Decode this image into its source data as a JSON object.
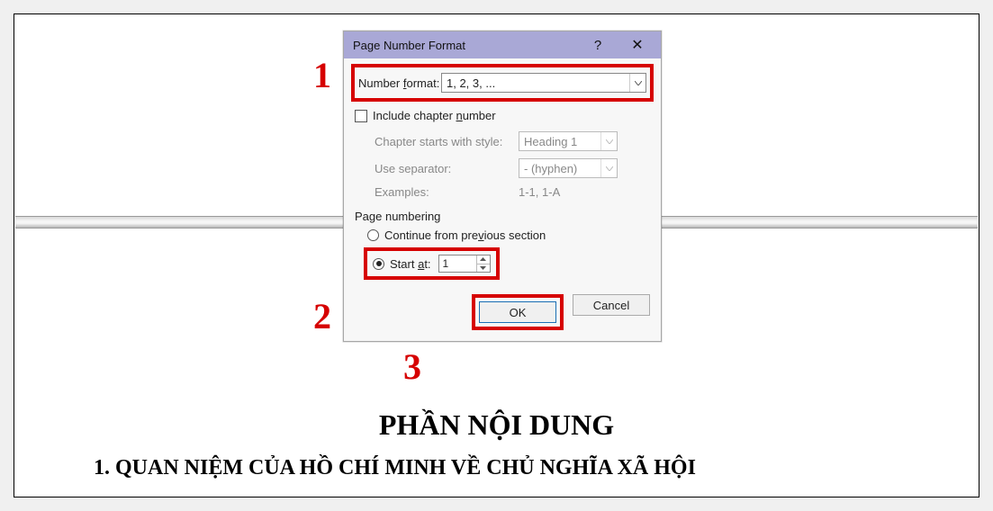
{
  "dialog": {
    "title": "Page Number Format",
    "help": "?",
    "close": "✕",
    "number_format_label_pre": "Number ",
    "number_format_label_u": "f",
    "number_format_label_post": "ormat:",
    "number_format_value": "1, 2, 3, ...",
    "include_chapter_pre": "Include chapter ",
    "include_chapter_u": "n",
    "include_chapter_post": "umber",
    "chapter_starts_label": "Chapter starts with style:",
    "chapter_starts_value": "Heading 1",
    "use_separator_label": "Use separator:",
    "use_separator_value": "-   (hyphen)",
    "examples_label": "Examples:",
    "examples_value": "1-1, 1-A",
    "page_numbering_label": "Page numbering",
    "continue_pre": "Continue from pre",
    "continue_u": "v",
    "continue_post": "ious section",
    "start_at_pre": "Start ",
    "start_at_u": "a",
    "start_at_post": "t:",
    "start_at_value": "1",
    "ok": "OK",
    "cancel": "Cancel"
  },
  "callouts": {
    "c1": "1",
    "c2": "2",
    "c3": "3"
  },
  "document": {
    "title": "PHẦN NỘI DUNG",
    "subtitle": "1.   QUAN NIỆM CỦA HỒ CHÍ MINH VỀ CHỦ NGHĨA XÃ HỘI"
  }
}
